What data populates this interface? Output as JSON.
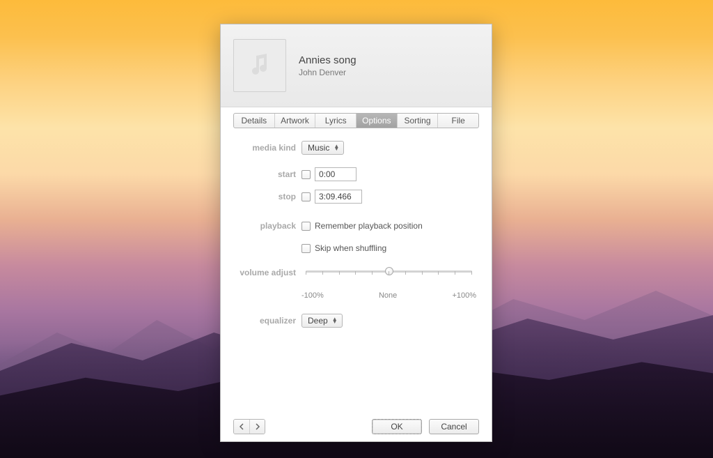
{
  "header": {
    "song_title": "Annies song",
    "artist": "John Denver"
  },
  "tabs": {
    "items": [
      "Details",
      "Artwork",
      "Lyrics",
      "Options",
      "Sorting",
      "File"
    ],
    "active_index": 3
  },
  "options": {
    "labels": {
      "media_kind": "media kind",
      "start": "start",
      "stop": "stop",
      "playback": "playback",
      "volume_adjust": "volume adjust",
      "equalizer": "equalizer"
    },
    "media_kind": {
      "value": "Music"
    },
    "start": {
      "checked": false,
      "value": "0:00"
    },
    "stop": {
      "checked": false,
      "value": "3:09.466"
    },
    "playback": {
      "remember_checked": false,
      "remember_label": "Remember playback position",
      "skip_checked": false,
      "skip_label": "Skip when shuffling"
    },
    "volume": {
      "left_label": "-100%",
      "center_label": "None",
      "right_label": "+100%",
      "value_percent": 0
    },
    "equalizer": {
      "value": "Deep"
    }
  },
  "footer": {
    "ok_label": "OK",
    "cancel_label": "Cancel"
  }
}
